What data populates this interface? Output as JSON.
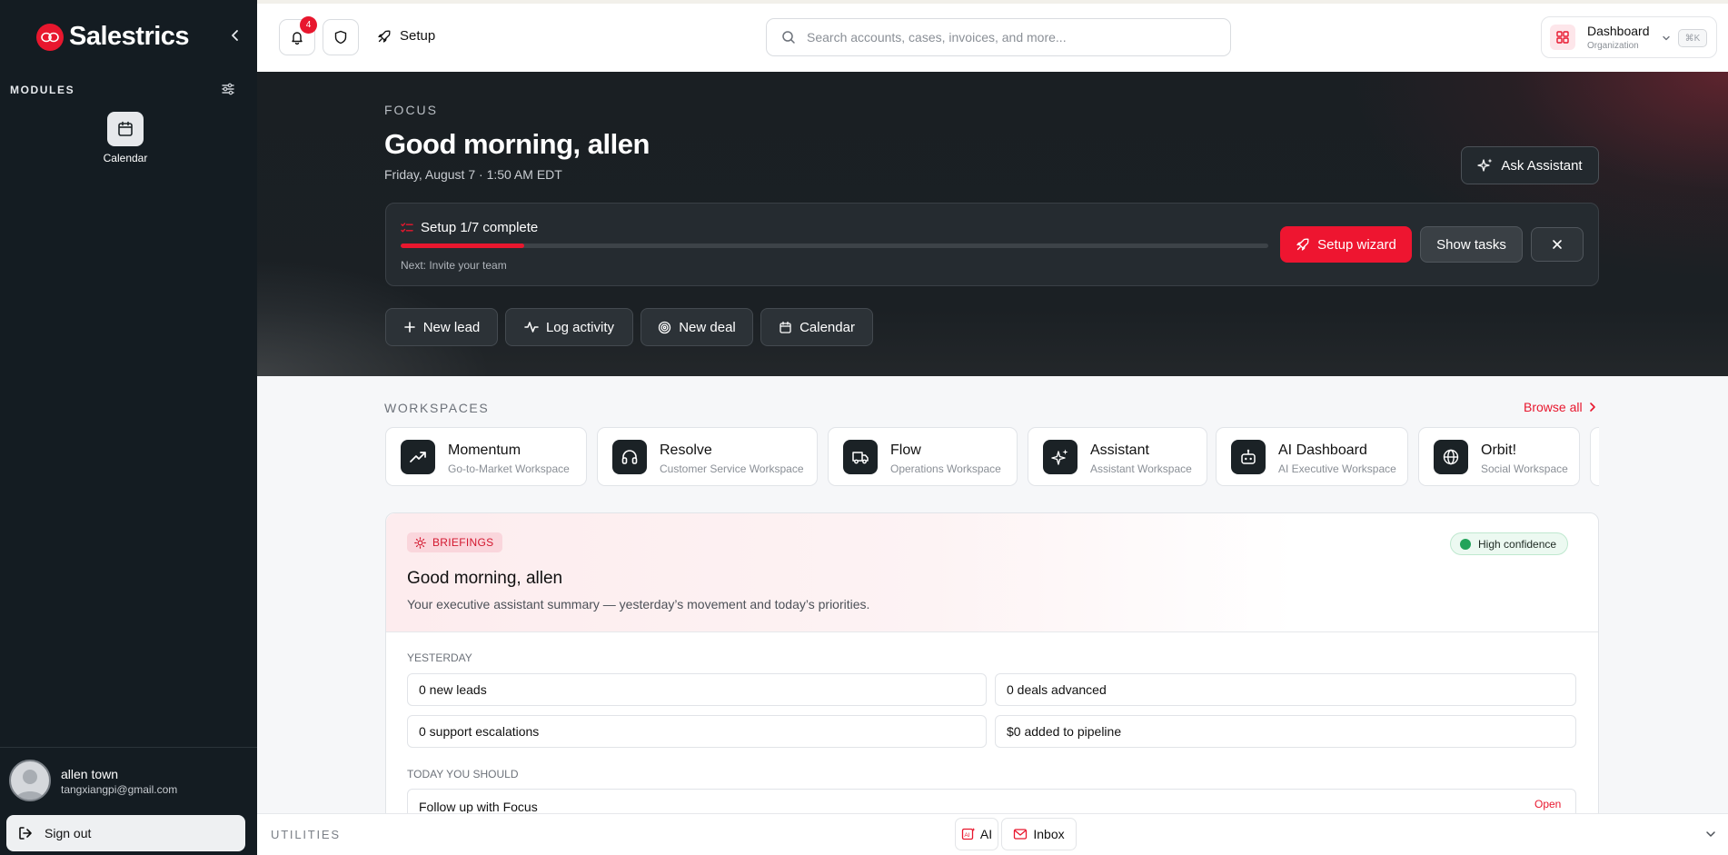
{
  "brand": {
    "name": "Salestrics"
  },
  "colors": {
    "accent": "#e8172e",
    "sidebar": "#141c22",
    "hero": "#1a1f23",
    "success": "#22a35a"
  },
  "sidebar": {
    "modules_label": "MODULES",
    "modules": [
      {
        "label": "Calendar",
        "icon": "calendar-icon"
      }
    ],
    "user": {
      "name": "allen town",
      "email": "tangxiangpi@gmail.com"
    },
    "signout_label": "Sign out"
  },
  "topbar": {
    "notifications_count": "4",
    "setup_label": "Setup",
    "search_placeholder": "Search accounts, cases, invoices, and more...",
    "dashboard_switcher": {
      "title": "Dashboard",
      "subtitle": "Organization",
      "shortcut": "⌘K"
    }
  },
  "hero": {
    "eyebrow": "FOCUS",
    "greeting": "Good morning, allen",
    "date": "Friday, August 7 · 1:50 AM EDT",
    "ask_assistant_label": "Ask Assistant",
    "setup_progress": {
      "title": "Setup 1/7 complete",
      "completed": 1,
      "total": 7,
      "next": "Next: Invite your team",
      "wizard_label": "Setup wizard",
      "show_tasks_label": "Show tasks"
    },
    "quick_actions": [
      {
        "label": "New lead",
        "icon": "plus-icon"
      },
      {
        "label": "Log activity",
        "icon": "activity-icon"
      },
      {
        "label": "New deal",
        "icon": "target-icon"
      },
      {
        "label": "Calendar",
        "icon": "calendar-icon"
      }
    ]
  },
  "workspaces": {
    "eyebrow": "WORKSPACES",
    "browse_all_label": "Browse all",
    "items": [
      {
        "name": "Momentum",
        "subtitle": "Go-to-Market Workspace",
        "icon": "trending-up-icon"
      },
      {
        "name": "Resolve",
        "subtitle": "Customer Service Workspace",
        "icon": "headphones-icon"
      },
      {
        "name": "Flow",
        "subtitle": "Operations Workspace",
        "icon": "truck-icon"
      },
      {
        "name": "Assistant",
        "subtitle": "Assistant Workspace",
        "icon": "sparkles-icon"
      },
      {
        "name": "AI Dashboard",
        "subtitle": "AI Executive Workspace",
        "icon": "bot-icon"
      },
      {
        "name": "Orbit!",
        "subtitle": "Social Workspace",
        "icon": "globe-icon"
      }
    ]
  },
  "briefings": {
    "badge": "BRIEFINGS",
    "confidence": "High confidence",
    "title": "Good morning, allen",
    "subtitle": "Your executive assistant summary — yesterday’s movement and today’s priorities.",
    "yesterday_label": "YESTERDAY",
    "stats": {
      "new_leads": "0 new leads",
      "deals_advanced": "0 deals advanced",
      "support_escalations": "0 support escalations",
      "pipeline_added": "$0 added to pipeline"
    },
    "today_label": "TODAY YOU SHOULD",
    "tasks": [
      {
        "text": "Follow up with Focus",
        "action": "Open"
      }
    ]
  },
  "utilities": {
    "label": "UTILITIES",
    "ai_label": "AI",
    "inbox_label": "Inbox"
  }
}
